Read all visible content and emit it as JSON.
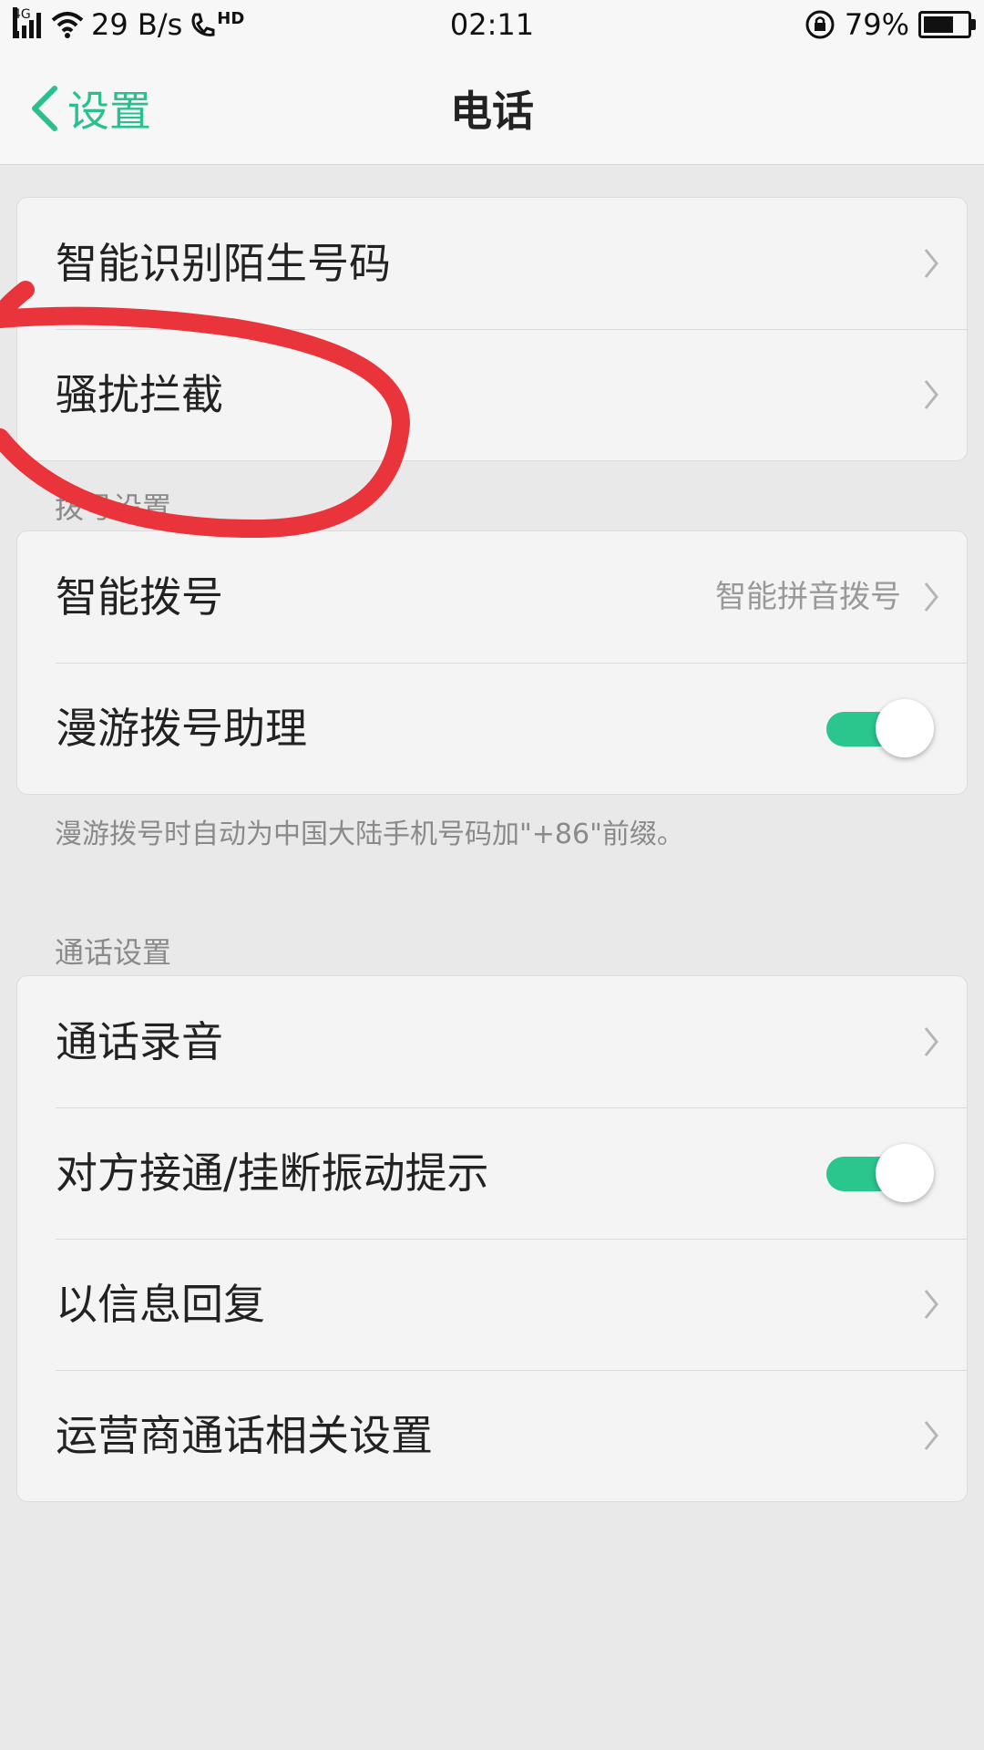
{
  "status_bar": {
    "network": "4G",
    "speed": "29 B/s",
    "volte": "HD",
    "time": "02:11",
    "battery_percent": "79%",
    "battery_level": 0.79
  },
  "nav": {
    "back_label": "设置",
    "title": "电话"
  },
  "group1": {
    "items": [
      {
        "label": "智能识别陌生号码"
      },
      {
        "label": "骚扰拦截"
      }
    ]
  },
  "dial_section": {
    "header": "拨号设置",
    "items": [
      {
        "label": "智能拨号",
        "value": "智能拼音拨号"
      },
      {
        "label": "漫游拨号助理",
        "toggle": true
      }
    ],
    "footnote": "漫游拨号时自动为中国大陆手机号码加\"+86\"前缀。"
  },
  "call_section": {
    "header": "通话设置",
    "items": [
      {
        "label": "通话录音"
      },
      {
        "label": "对方接通/挂断振动提示",
        "toggle": true
      },
      {
        "label": "以信息回复"
      },
      {
        "label": "运营商通话相关设置"
      }
    ]
  },
  "colors": {
    "accent": "#2bbf8d",
    "toggle_on": "#2bc58e",
    "annotation": "#e8343a"
  }
}
